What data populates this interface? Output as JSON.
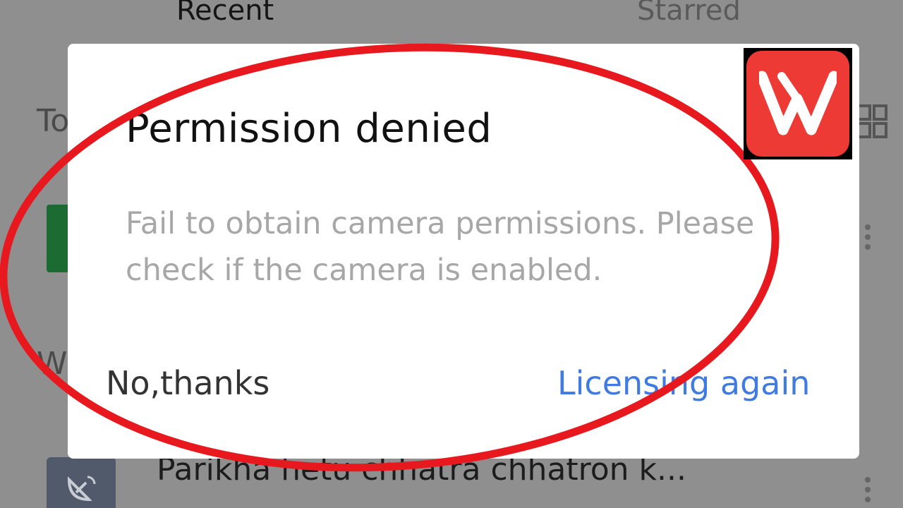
{
  "background_app": {
    "tabs": [
      "Recent",
      "Starred"
    ],
    "partial_left_text_1": "To",
    "partial_left_text_2": "W",
    "file_name": "Parikha hetu chhatra chhatron k..."
  },
  "dialog": {
    "title": "Permission denied",
    "message": "Fail to obtain camera permissions. Please check if the camera is enabled.",
    "negative_button": "No,thanks",
    "positive_button": "Licensing again"
  },
  "colors": {
    "annotation_circle": "#e8191e",
    "positive_button": "#3f7be0",
    "logo_background": "#ee3a35"
  },
  "icons": {
    "logo": "wps-office-logo-icon",
    "grid_view": "grid-view-icon",
    "more_options": "more-vertical-icon",
    "file_thumbnail": "satellite-dish-icon"
  }
}
